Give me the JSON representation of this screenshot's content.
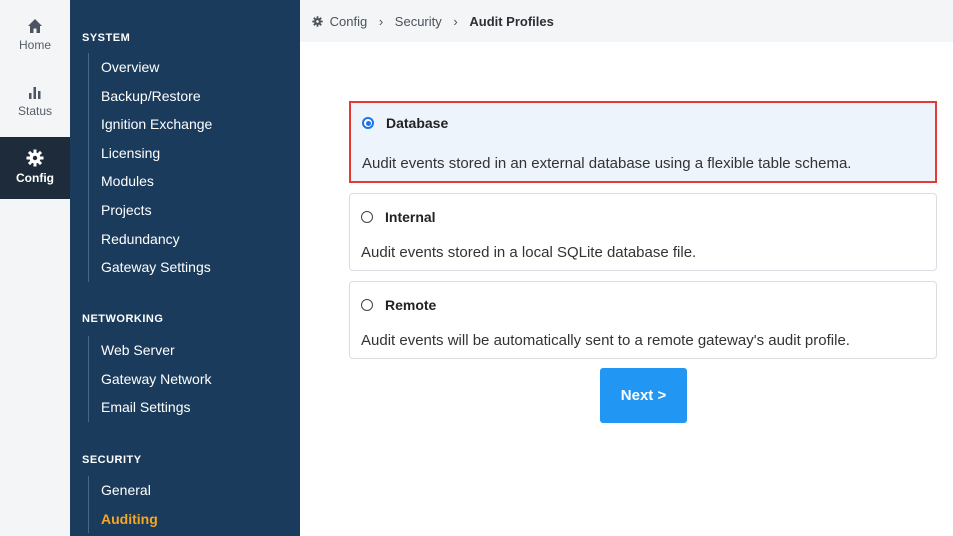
{
  "rail": {
    "home": "Home",
    "status": "Status",
    "config": "Config"
  },
  "sidebar": {
    "system": {
      "title": "SYSTEM",
      "items": [
        "Overview",
        "Backup/Restore",
        "Ignition Exchange",
        "Licensing",
        "Modules",
        "Projects",
        "Redundancy",
        "Gateway Settings"
      ]
    },
    "networking": {
      "title": "NETWORKING",
      "items": [
        "Web Server",
        "Gateway Network",
        "Email Settings"
      ]
    },
    "security": {
      "title": "SECURITY",
      "items": [
        "General",
        "Auditing"
      ]
    }
  },
  "breadcrumb": {
    "config": "Config",
    "security": "Security",
    "current": "Audit Profiles"
  },
  "options": [
    {
      "title": "Database",
      "desc": "Audit events stored in an external database using a flexible table schema.",
      "selected": true
    },
    {
      "title": "Internal",
      "desc": "Audit events stored in a local SQLite database file.",
      "selected": false
    },
    {
      "title": "Remote",
      "desc": "Audit events will be automatically sent to a remote gateway's audit profile.",
      "selected": false
    }
  ],
  "next_label": "Next >",
  "colors": {
    "sidebar_bg": "#1a3b5b",
    "active_item": "#f5a623",
    "button": "#2196f3",
    "highlight": "#e53935"
  }
}
